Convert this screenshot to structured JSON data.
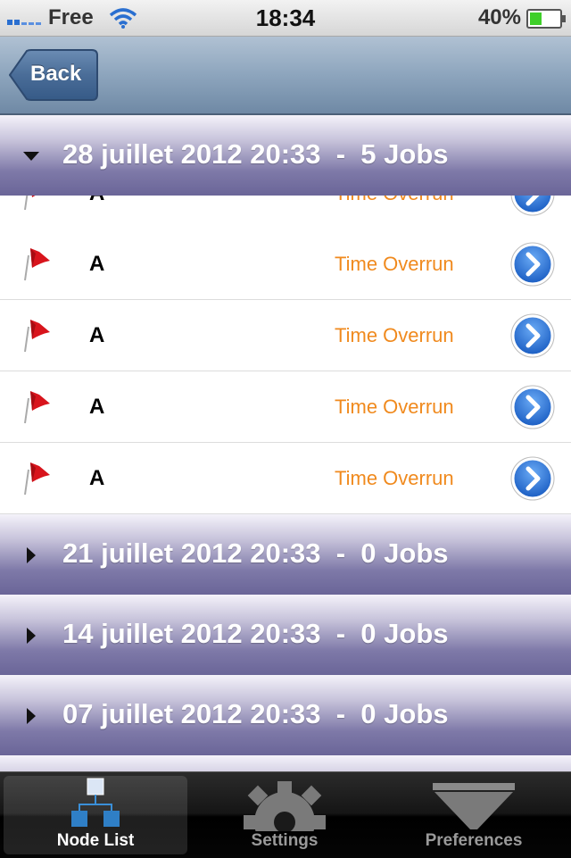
{
  "status_bar": {
    "carrier": "Free",
    "time": "18:34",
    "battery_percent": "40%",
    "battery_level": 0.4
  },
  "nav": {
    "back_label": "Back"
  },
  "sections": [
    {
      "title": "28 juillet 2012 20:33  -  5 Jobs",
      "expanded": true
    },
    {
      "title": "21 juillet 2012 20:33  -  0 Jobs",
      "expanded": false
    },
    {
      "title": "14 juillet 2012 20:33  -  0 Jobs",
      "expanded": false
    },
    {
      "title": "07 juillet 2012 20:33  -  0 Jobs",
      "expanded": false
    }
  ],
  "jobs": [
    {
      "name": "A",
      "status": "Time Overrun"
    },
    {
      "name": "A",
      "status": "Time Overrun"
    },
    {
      "name": "A",
      "status": "Time Overrun"
    },
    {
      "name": "A",
      "status": "Time Overrun"
    },
    {
      "name": "A",
      "status": "Time Overrun"
    }
  ],
  "tabs": [
    {
      "label": "Node List",
      "icon": "node-list-icon",
      "selected": true
    },
    {
      "label": "Settings",
      "icon": "gear-icon",
      "selected": false
    },
    {
      "label": "Preferences",
      "icon": "funnel-icon",
      "selected": false
    }
  ],
  "colors": {
    "status_text": "#f08a1e",
    "section_header": "#6a6598",
    "nav_bar": "#8da5bd",
    "disclosure_button": "#2c79df",
    "flag": "#d8141c"
  }
}
